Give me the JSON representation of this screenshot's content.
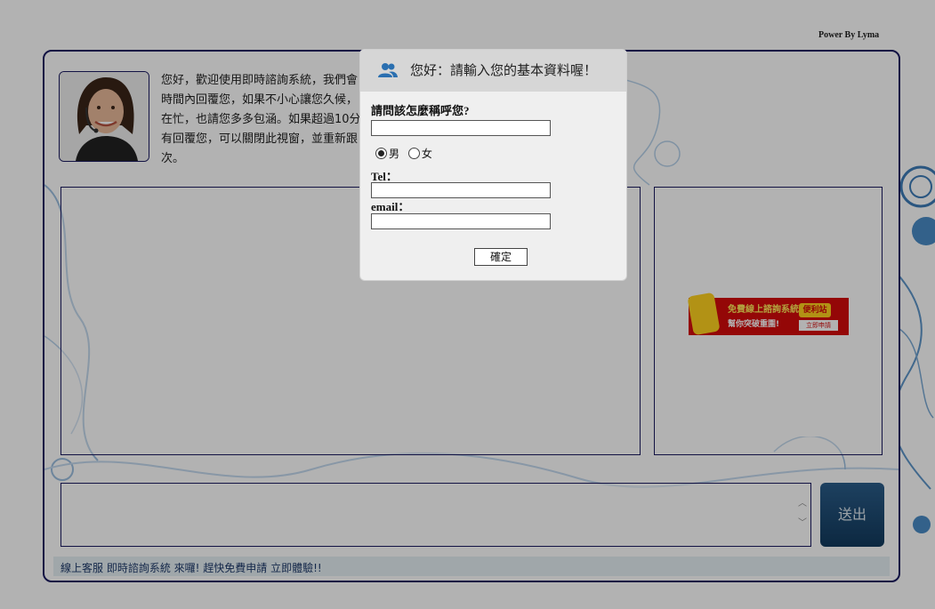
{
  "header": {
    "power_by": "Power By Lyma"
  },
  "intro": {
    "lines": [
      "您好，歡迎使用即時諮詢系統，我們會",
      "時間內回覆您，如果不小心讓您久候，",
      "在忙，也請您多多包涵。如果超過10分",
      "有回覆您，可以關閉此視窗，並重新跟",
      "次。"
    ]
  },
  "ad": {
    "line1": "免費線上諮詢系統",
    "line2": "幫你突破重圍!",
    "logo_text": "便利站",
    "button_text": "立即申請"
  },
  "composer": {
    "send_label": "送出",
    "scroll_up": "︿",
    "scroll_down": "﹀"
  },
  "footer": {
    "text": "線上客服 即時諮詢系統 來囉! 趕快免費申請 立即體驗!!"
  },
  "modal": {
    "title": "您好：請輸入您的基本資料喔！",
    "name_label": "請問該怎麼稱呼您?",
    "name_value": "",
    "gender_options": [
      "男",
      "女"
    ],
    "gender_selected": "男",
    "tel_label": "Tel：",
    "tel_value": "",
    "email_label": "email：",
    "email_value": "",
    "confirm_label": "確定"
  },
  "colors": {
    "border": "#1a1a60",
    "send_button": "#1f4b72",
    "ad_red": "#d40b0b",
    "icon_blue": "#2a6fb0"
  }
}
